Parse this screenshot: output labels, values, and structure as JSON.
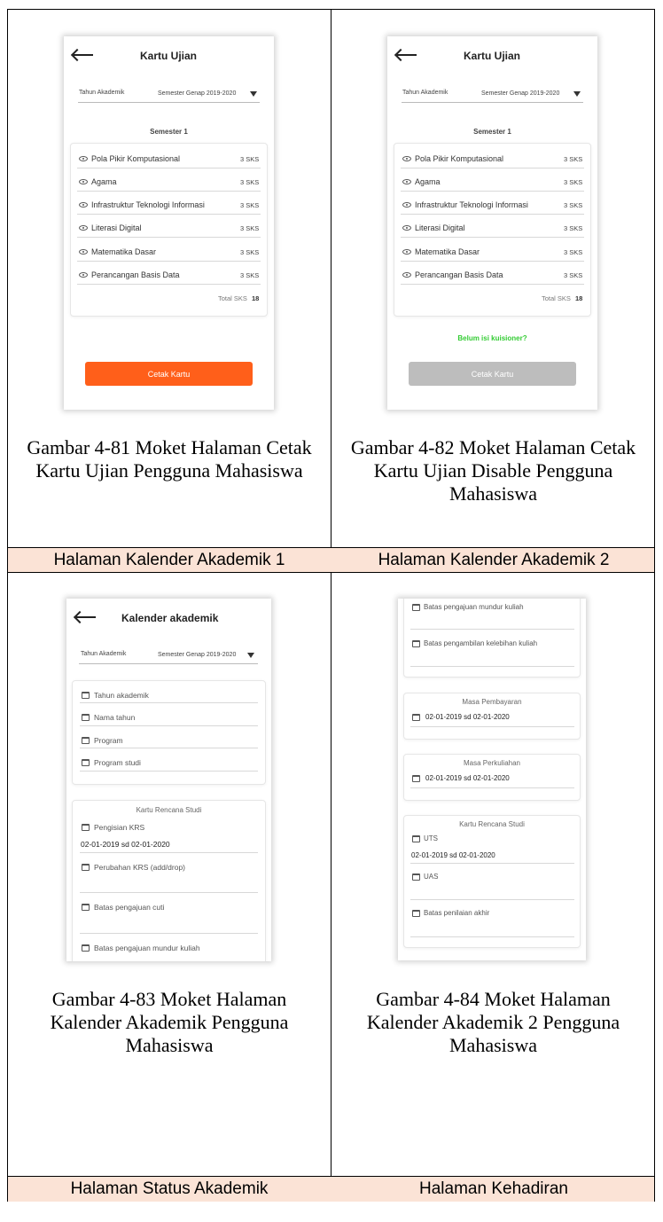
{
  "row_labels": {
    "row1_left": "Halaman Kalender Akademik 1",
    "row1_right": "Halaman Kalender Akademik 2",
    "row2_left": "Halaman Status Akademik",
    "row2_right": "Halaman Kehadiran"
  },
  "captions": {
    "fig81": [
      "Gambar 4-81 Moket Halaman Cetak",
      "Kartu Ujian Pengguna Mahasiswa"
    ],
    "fig82": [
      "Gambar 4-82 Moket Halaman Cetak",
      "Kartu Ujian Disable Pengguna",
      "Mahasiswa"
    ],
    "fig83": [
      "Gambar 4-83 Moket Halaman",
      "Kalender Akademik Pengguna",
      "Mahasiswa"
    ],
    "fig84": [
      "Gambar 4-84 Moket Halaman",
      "Kalender Akademik 2 Pengguna",
      "Mahasiswa"
    ]
  },
  "kartu": {
    "title": "Kartu Ujian",
    "tahun_label": "Tahun Akademik",
    "tahun_value": "Semester Genap 2019-2020",
    "semester": "Semester 1",
    "courses": [
      {
        "name": "Pola Pikir Komputasional",
        "sks": "3 SKS"
      },
      {
        "name": "Agama",
        "sks": "3 SKS"
      },
      {
        "name": "Infrastruktur Teknologi Informasi",
        "sks": "3 SKS"
      },
      {
        "name": "Literasi Digital",
        "sks": "3 SKS"
      },
      {
        "name": "Matematika Dasar",
        "sks": "3 SKS"
      },
      {
        "name": "Perancangan Basis Data",
        "sks": "3 SKS"
      }
    ],
    "total_label": "Total SKS",
    "total_value": "18",
    "button": "Cetak Kartu",
    "kuisioner": "Belum isi kuisioner?",
    "colors": {
      "primary": "#ff5f1a",
      "disabled": "#bdbdbd",
      "warning": "#33cc33"
    }
  },
  "kalender1": {
    "title": "Kalender akademik",
    "tahun_label": "Tahun Akademik",
    "tahun_value": "Semester Genap 2019-2020",
    "fields": [
      "Tahun akademik",
      "Nama tahun",
      "Program",
      "Program studi"
    ],
    "krs_title": "Kartu Rencana Studi",
    "krs_items": [
      {
        "label": "Pengisian KRS",
        "value": "02-01-2019 sd 02-01-2020"
      },
      {
        "label": "Perubahan KRS (add/drop)",
        "value": ""
      },
      {
        "label": "Batas pengajuan cuti",
        "value": ""
      },
      {
        "label": "Batas pengajuan mundur kuliah",
        "value": ""
      }
    ]
  },
  "kalender2": {
    "top_items": [
      "Batas pengajuan mundur kuliah",
      "Batas pengambilan kelebihan kuliah"
    ],
    "pembayaran_title": "Masa Pembayaran",
    "pembayaran_value": "02-01-2019 sd 02-01-2020",
    "perkuliahan_title": "Masa Perkuliahan",
    "perkuliahan_value": "02-01-2019 sd 02-01-2020",
    "krs_title": "Kartu Rencana Studi",
    "uts_label": "UTS",
    "uts_value": "02-01-2019 sd 02-01-2020",
    "uas_label": "UAS",
    "nilai_label": "Batas penilaian akhir"
  }
}
